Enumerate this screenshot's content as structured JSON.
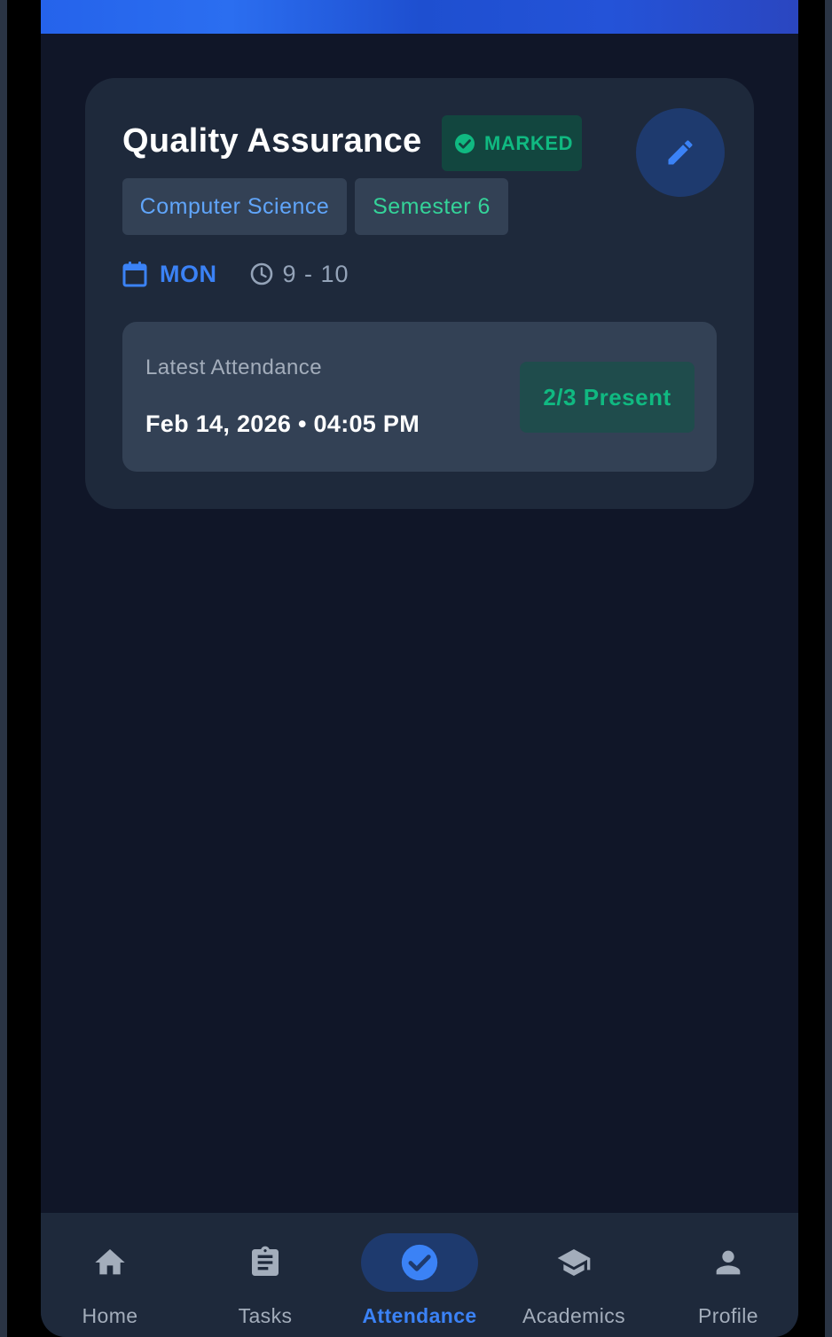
{
  "card": {
    "title": "Quality Assurance",
    "status_badge": "MARKED",
    "department": "Computer Science",
    "semester": "Semester 6",
    "day": "MON",
    "time": "9 - 10",
    "latest_label": "Latest Attendance",
    "latest_datetime": "Feb 14, 2026 • 04:05 PM",
    "present_summary": "2/3 Present",
    "edit_icon": "pencil-icon"
  },
  "nav": {
    "items": [
      {
        "label": "Home",
        "icon": "home-icon"
      },
      {
        "label": "Tasks",
        "icon": "clipboard-icon"
      },
      {
        "label": "Attendance",
        "icon": "check-circle-icon",
        "active": true
      },
      {
        "label": "Academics",
        "icon": "graduation-cap-icon"
      },
      {
        "label": "Profile",
        "icon": "person-icon"
      }
    ]
  },
  "colors": {
    "background": "#101628",
    "card": "#1e293b",
    "accent_blue": "#3b82f6",
    "success_green": "#10b981",
    "muted_text": "#94a3b8"
  }
}
